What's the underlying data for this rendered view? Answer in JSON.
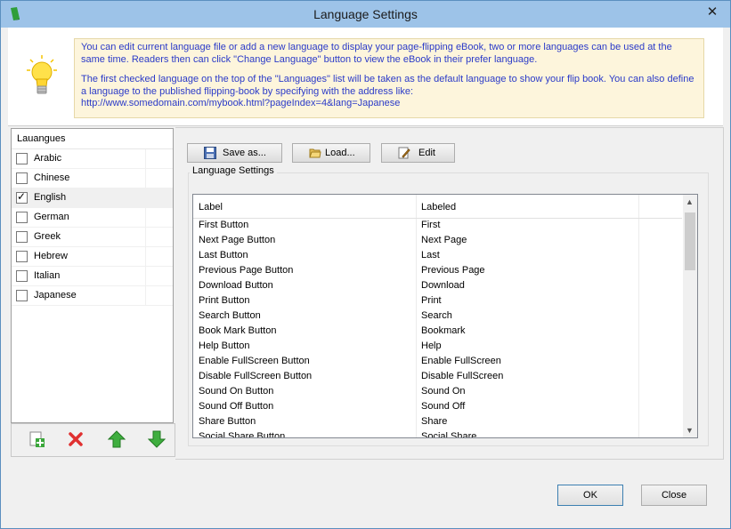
{
  "window": {
    "title": "Language Settings",
    "close_glyph": "✕"
  },
  "info": {
    "paragraph1": "You can edit current language file or add a new language to display your page-flipping eBook, two or more languages can be used at the same time. Readers then can click \"Change Language\" button to view the eBook in their prefer language.",
    "paragraph2": "The first checked language on the top of the \"Languages\" list will be taken as the default language to show your flip book. You can also define a language to the published flipping-book by specifying with the address like:",
    "url": "http://www.somedomain.com/mybook.html?pageIndex=4&lang=Japanese",
    "icon": "lightbulb-icon"
  },
  "languages": {
    "header": "Lauangues",
    "items": [
      {
        "label": "Arabic",
        "checked": false
      },
      {
        "label": "Chinese",
        "checked": false
      },
      {
        "label": "English",
        "checked": true
      },
      {
        "label": "German",
        "checked": false
      },
      {
        "label": "Greek",
        "checked": false
      },
      {
        "label": "Hebrew",
        "checked": false
      },
      {
        "label": "Italian",
        "checked": false
      },
      {
        "label": "Japanese",
        "checked": false
      }
    ]
  },
  "toolbar": {
    "save_label": "Save as...",
    "load_label": "Load...",
    "edit_label": "Edit"
  },
  "settings": {
    "group_label": "Language Settings",
    "col_label": "Label",
    "col_labeled": "Labeled",
    "rows": [
      {
        "label": "First Button",
        "labeled": "First"
      },
      {
        "label": "Next Page Button",
        "labeled": "Next Page"
      },
      {
        "label": "Last Button",
        "labeled": "Last"
      },
      {
        "label": "Previous Page Button",
        "labeled": "Previous Page"
      },
      {
        "label": "Download Button",
        "labeled": "Download"
      },
      {
        "label": "Print Button",
        "labeled": "Print"
      },
      {
        "label": "Search Button",
        "labeled": "Search"
      },
      {
        "label": "Book Mark Button",
        "labeled": "Bookmark"
      },
      {
        "label": "Help Button",
        "labeled": "Help"
      },
      {
        "label": "Enable FullScreen Button",
        "labeled": "Enable FullScreen"
      },
      {
        "label": "Disable FullScreen Button",
        "labeled": "Disable FullScreen"
      },
      {
        "label": "Sound On Button",
        "labeled": "Sound On"
      },
      {
        "label": "Sound Off Button",
        "labeled": "Sound Off"
      },
      {
        "label": "Share Button",
        "labeled": "Share"
      },
      {
        "label": "Social Share Button",
        "labeled": "Social Share"
      }
    ]
  },
  "footer": {
    "ok_label": "OK",
    "close_label": "Close"
  },
  "colors": {
    "title_bar": "#9dc3e8",
    "info_text": "#2a3ac8",
    "info_bg": "#fdf5dc"
  }
}
